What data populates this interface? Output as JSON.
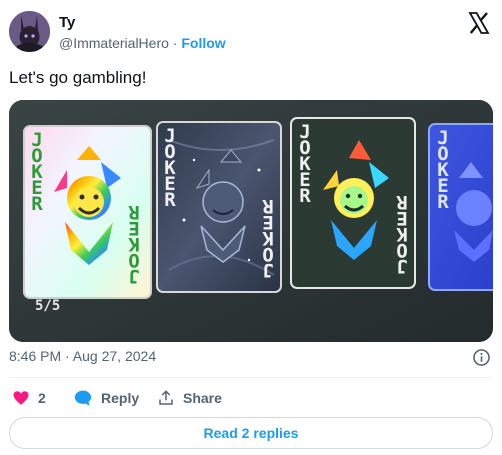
{
  "author": {
    "display_name": "Ty",
    "handle": "@ImmaterialHero",
    "separator": "·",
    "follow_label": "Follow"
  },
  "tweet": {
    "text": "Let's go gambling!",
    "timestamp": "8:46 PM · Aug 27, 2024"
  },
  "media": {
    "card_label": "JOKER",
    "counter": "5/5"
  },
  "actions": {
    "like_count": "2",
    "reply_label": "Reply",
    "share_label": "Share"
  },
  "read_replies_label": "Read 2 replies",
  "colors": {
    "accent": "#1d9bf0",
    "like": "#f91880",
    "text_secondary": "#536471"
  }
}
